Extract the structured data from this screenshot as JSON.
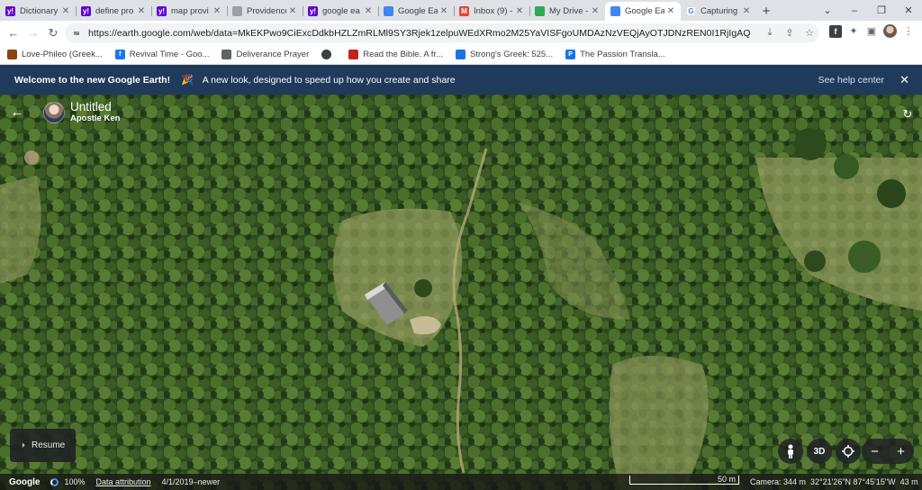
{
  "tabs": [
    {
      "title": "Dictionary",
      "favicon": "yahoo-icon",
      "color": "#6001d2",
      "letter": "y!",
      "active": false
    },
    {
      "title": "define pro",
      "favicon": "yahoo-icon",
      "color": "#6001d2",
      "letter": "y!",
      "active": false
    },
    {
      "title": "map provi",
      "favicon": "yahoo-icon",
      "color": "#6001d2",
      "letter": "y!",
      "active": false
    },
    {
      "title": "Providence",
      "favicon": "globe-icon",
      "color": "#9aa0a6",
      "letter": "",
      "active": false
    },
    {
      "title": "google ea",
      "favicon": "yahoo-icon",
      "color": "#6001d2",
      "letter": "y!",
      "active": false
    },
    {
      "title": "Google Ea",
      "favicon": "google-earth-icon",
      "color": "#4285f4",
      "letter": "",
      "active": false
    },
    {
      "title": "Inbox (9) -",
      "favicon": "gmail-icon",
      "color": "#ea4335",
      "letter": "M",
      "active": false
    },
    {
      "title": "My Drive -",
      "favicon": "google-drive-icon",
      "color": "#34a853",
      "letter": "",
      "active": false
    },
    {
      "title": "Google Ea",
      "favicon": "google-earth-icon",
      "color": "#4285f4",
      "letter": "",
      "active": true
    },
    {
      "title": "Capturing",
      "favicon": "google-g-icon",
      "color": "#ffffff",
      "letter": "G",
      "active": false
    }
  ],
  "window": {
    "new_tab": "+",
    "chevron": "⌄",
    "minimize": "–",
    "maximize": "❐",
    "close": "✕"
  },
  "toolbar": {
    "url": "https://earth.google.com/web/data=MkEKPwo9CiExcDdkbHZLZmRLMl9SY3Rjek1zelpuWEdXRmo2M25YaVISFgoUMDAzNzVEQjAyOTJDNzREN0I1RjIgAQ",
    "back": "←",
    "forward": "→",
    "reload": "↻"
  },
  "bookmarks": [
    {
      "label": "Love-Phileo (Greek...",
      "color": "#8b4513",
      "letter": ""
    },
    {
      "label": "Revival Time - Goo...",
      "color": "#1877f2",
      "letter": "f"
    },
    {
      "label": "Deliverance Prayer",
      "color": "#5f6368",
      "letter": ""
    },
    {
      "label": "",
      "color": "#3c4043",
      "letter": ""
    },
    {
      "label": "Read the Bible. A fr...",
      "color": "#c5221f",
      "letter": ""
    },
    {
      "label": "Strong's Greek: 525...",
      "color": "#1a73e8",
      "letter": ""
    },
    {
      "label": "The Passion Transla...",
      "color": "#1a73e8",
      "letter": "P"
    }
  ],
  "banner": {
    "title": "Welcome to the new Google Earth!",
    "emoji": "🎉",
    "text": "A new look, designed to speed up how you create and share",
    "link": "See help center",
    "close": "✕"
  },
  "project": {
    "title": "Untitled",
    "owner": "Apostle Ken",
    "back": "←",
    "rotate": "↻"
  },
  "resume": {
    "label": "Resume",
    "icon": "⏵"
  },
  "controls": {
    "pegman": "pegman-icon",
    "three_d": "3D",
    "zoom_out": "−",
    "zoom_in": "+"
  },
  "status": {
    "logo": "Google",
    "load_percent": "100%",
    "attribution": "Data attribution",
    "imagery_date": "4/1/2019–newer",
    "scale": "50 m",
    "camera": "Camera: 344 m",
    "coords": "32°21'26\"N 87°45'15\"W",
    "elevation": "43 m"
  }
}
